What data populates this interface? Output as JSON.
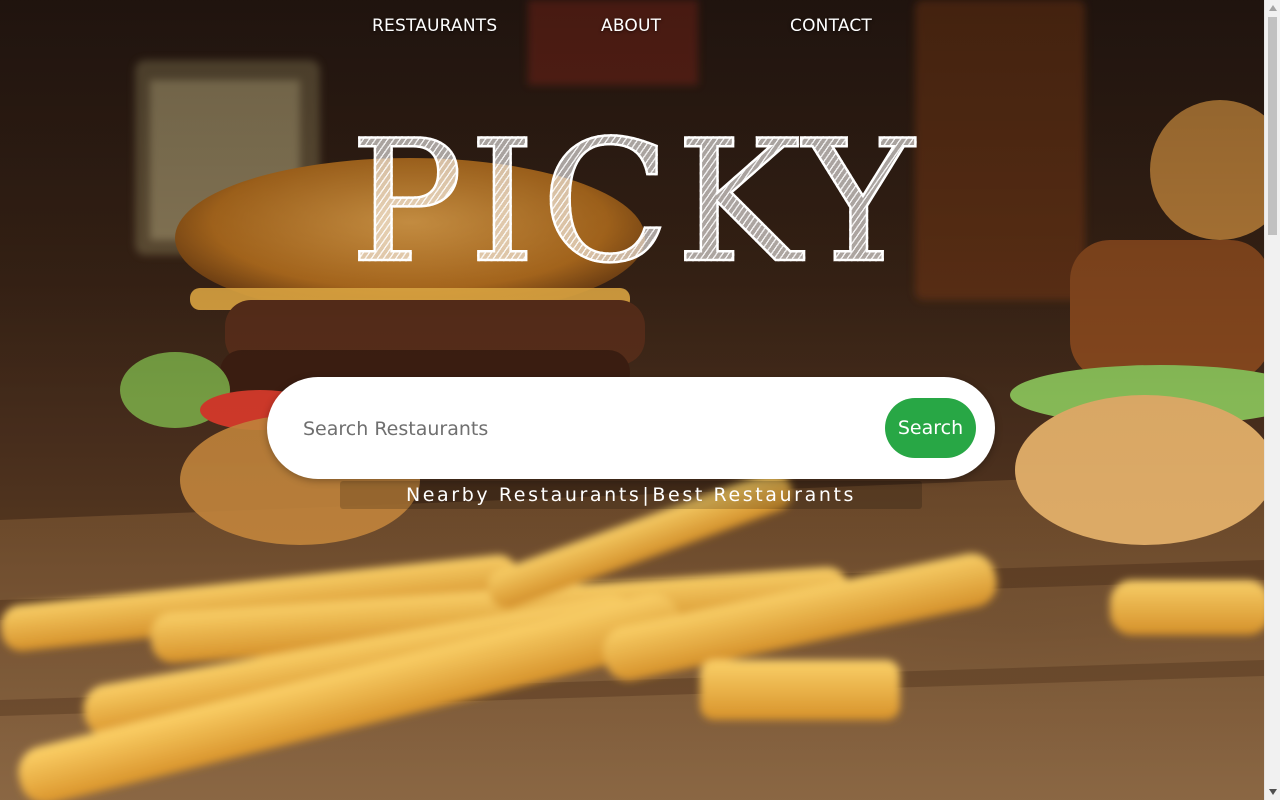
{
  "nav": {
    "items": [
      {
        "label": "RESTAURANTS"
      },
      {
        "label": "ABOUT"
      },
      {
        "label": "CONTACT"
      }
    ]
  },
  "hero": {
    "logo_text": "PICKY",
    "background": "burger-and-fries-photo"
  },
  "search": {
    "placeholder": "Search Restaurants",
    "value": "",
    "button_label": "Search"
  },
  "sub_links": {
    "nearby_label": "Nearby Restaurants",
    "separator": "|",
    "best_label": "Best Restaurants"
  },
  "colors": {
    "accent": "#28a745",
    "nav_text": "#ffffff",
    "search_bg": "#ffffff"
  },
  "icons": {
    "scroll_up": "triangle-up-icon",
    "scroll_down": "triangle-down-icon"
  }
}
